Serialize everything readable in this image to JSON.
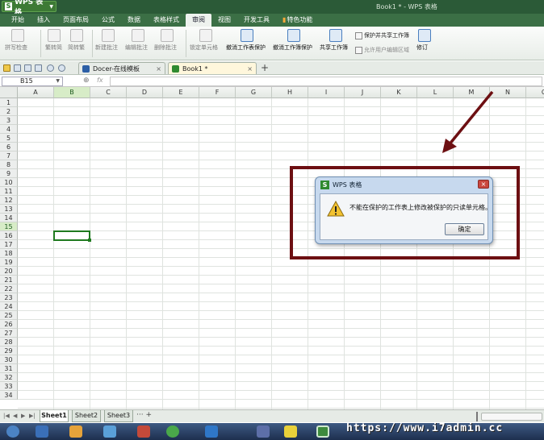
{
  "titlebar": {
    "app_button": "WPS 表格",
    "window_title": "Book1 * - WPS 表格"
  },
  "menu": {
    "items": [
      "开始",
      "插入",
      "页面布局",
      "公式",
      "数据",
      "表格样式",
      "审阅",
      "视图",
      "开发工具",
      "特色功能"
    ],
    "active": "审阅"
  },
  "ribbon": {
    "spell_check": "拼写检查",
    "trad_to_simp": "繁转简",
    "simp_to_trad": "简转繁",
    "new_comment": "新建批注",
    "edit_comment": "编辑批注",
    "delete_comment": "删除批注",
    "lock_cell": "锁定单元格",
    "unprotect_sheet": "撤消工作表保护",
    "unprotect_workbook": "撤消工作簿保护",
    "share_workbook": "共享工作簿",
    "protect_and_share": "保护并共享工作簿",
    "allow_edit_ranges": "允许用户编辑区域",
    "track_changes": "修订"
  },
  "tabs": {
    "docer": "Docer-在线模板",
    "book": "Book1 *",
    "close_glyph": "×"
  },
  "formula_bar": {
    "cell_ref": "B15",
    "zoom_glyph": "⊕",
    "fx_label": "fx",
    "formula": ""
  },
  "columns": [
    "A",
    "B",
    "C",
    "D",
    "E",
    "F",
    "G",
    "H",
    "I",
    "J",
    "K",
    "L",
    "M",
    "N",
    "O"
  ],
  "selected_column": "B",
  "rows": [
    "1",
    "2",
    "3",
    "4",
    "5",
    "6",
    "7",
    "8",
    "9",
    "10",
    "11",
    "12",
    "13",
    "14",
    "15",
    "16",
    "17",
    "18",
    "19",
    "20",
    "21",
    "22",
    "23",
    "24",
    "25",
    "26",
    "27",
    "28",
    "29",
    "30",
    "31",
    "32",
    "33",
    "34"
  ],
  "selected_row": "15",
  "dialog": {
    "title": "WPS 表格",
    "message": "不能在保护的工作表上修改被保护的只读单元格。",
    "ok": "确定",
    "close_glyph": "×"
  },
  "sheets": {
    "tabs": [
      "Sheet1",
      "Sheet2",
      "Sheet3"
    ],
    "active": "Sheet1",
    "more": "···  +"
  },
  "watermark": "https://www.i7admin.cc",
  "colors": {
    "annotation": "#6d0f12",
    "selection": "#1f7a1f",
    "titlebar": "#2b5a37"
  }
}
